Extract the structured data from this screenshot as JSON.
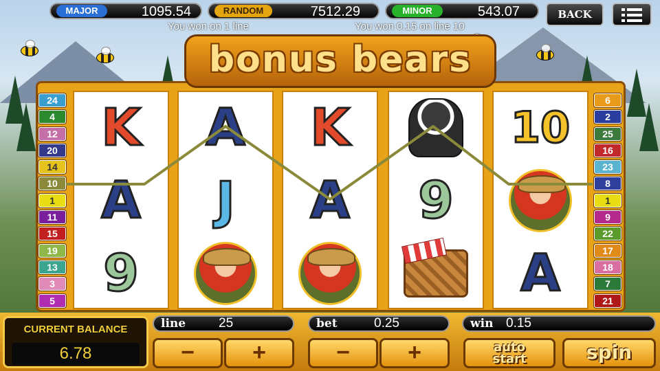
{
  "jackpots": [
    {
      "label": "MAJOR",
      "value": "1095.54",
      "color": "#2a6fd6"
    },
    {
      "label": "RANDOM",
      "value": "7512.29",
      "color": "#e5a50f"
    },
    {
      "label": "MINOR",
      "value": "543.07",
      "color": "#28b12a"
    }
  ],
  "messages": {
    "left": "You won on 1 line",
    "right": "You won 0.15 on line 10"
  },
  "top_buttons": {
    "back": "BACK",
    "menu_icon": "hamburger-menu-icon"
  },
  "logo": {
    "text": "bonus bears"
  },
  "left_lines": [
    {
      "n": "24",
      "color": "#3a9fd0"
    },
    {
      "n": "4",
      "color": "#2e8a2e"
    },
    {
      "n": "12",
      "color": "#c46fa8"
    },
    {
      "n": "20",
      "color": "#333a8c"
    },
    {
      "n": "14",
      "color": "#e6c21c"
    },
    {
      "n": "10",
      "color": "#8a8a3a"
    },
    {
      "n": "1",
      "color": "#e8dd12"
    },
    {
      "n": "11",
      "color": "#7a1f9c"
    },
    {
      "n": "15",
      "color": "#c02020"
    },
    {
      "n": "19",
      "color": "#8fb84a"
    },
    {
      "n": "13",
      "color": "#3ca58f"
    },
    {
      "n": "3",
      "color": "#e08ab8"
    },
    {
      "n": "5",
      "color": "#b02cb0"
    }
  ],
  "right_lines": [
    {
      "n": "6",
      "color": "#e89a1a"
    },
    {
      "n": "2",
      "color": "#2a3ea0"
    },
    {
      "n": "25",
      "color": "#3d7a3d"
    },
    {
      "n": "16",
      "color": "#c0282c"
    },
    {
      "n": "23",
      "color": "#5ab3cf"
    },
    {
      "n": "8",
      "color": "#2e3f9c"
    },
    {
      "n": "1",
      "color": "#e8dd12"
    },
    {
      "n": "9",
      "color": "#b42a8c"
    },
    {
      "n": "22",
      "color": "#5a9a2a"
    },
    {
      "n": "17",
      "color": "#e08a1a"
    },
    {
      "n": "18",
      "color": "#d86fa0"
    },
    {
      "n": "7",
      "color": "#2c7a3a"
    },
    {
      "n": "21",
      "color": "#b01818"
    }
  ],
  "reels": [
    [
      {
        "sym": "K",
        "kind": "red"
      },
      {
        "sym": "A",
        "kind": "navy"
      },
      {
        "sym": "9",
        "kind": "green"
      }
    ],
    [
      {
        "sym": "A",
        "kind": "navy"
      },
      {
        "sym": "J",
        "kind": "sky"
      },
      {
        "sym": "",
        "kind": "ranger"
      }
    ],
    [
      {
        "sym": "K",
        "kind": "red"
      },
      {
        "sym": "A",
        "kind": "navy"
      },
      {
        "sym": "",
        "kind": "ranger"
      }
    ],
    [
      {
        "sym": "",
        "kind": "skunk"
      },
      {
        "sym": "9",
        "kind": "green"
      },
      {
        "sym": "",
        "kind": "basket"
      }
    ],
    [
      {
        "sym": "10",
        "kind": "gold"
      },
      {
        "sym": "",
        "kind": "ranger"
      },
      {
        "sym": "A",
        "kind": "navy"
      }
    ]
  ],
  "winning_line": {
    "number": "10",
    "color": "#8a8a3a"
  },
  "balance": {
    "title": "CURRENT BALANCE",
    "value": "6.78"
  },
  "stats": {
    "line_label": "line",
    "line_value": "25",
    "bet_label": "bet",
    "bet_value": "0.25",
    "win_label": "win",
    "win_value": "0.15"
  },
  "controls": {
    "minus": "−",
    "plus": "+",
    "auto_start": "auto start",
    "spin": "spin"
  }
}
